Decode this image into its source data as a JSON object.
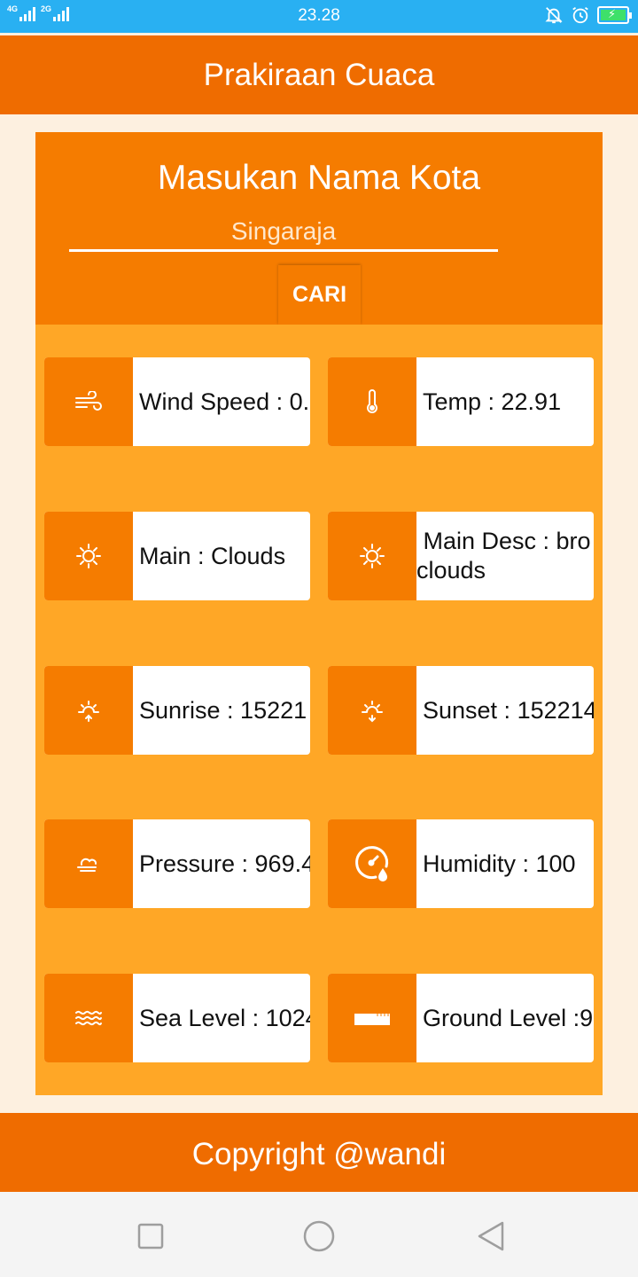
{
  "status_bar": {
    "network_1": "4G",
    "network_2": "2G",
    "time": "23.28",
    "icons": [
      "signal-icon",
      "signal-icon",
      "bell-off-icon",
      "alarm-icon",
      "battery-charging-icon"
    ]
  },
  "app_bar": {
    "title": "Prakiraan Cuaca"
  },
  "search": {
    "title": "Masukan Nama Kota",
    "city_value": "Singaraja",
    "button_label": "CARI"
  },
  "tiles": [
    {
      "icon": "wind-icon",
      "label": "Wind Speed : 0.",
      "interactable": false
    },
    {
      "icon": "thermometer-icon",
      "label": "Temp : 22.91"
    },
    {
      "icon": "sun-icon",
      "label": "Main : Clouds"
    },
    {
      "icon": "sun-icon",
      "label_line1": " Main Desc : bro",
      "label_line2": "clouds"
    },
    {
      "icon": "sunrise-icon",
      "label": "Sunrise : 15221"
    },
    {
      "icon": "sunset-icon",
      "label": "Sunset : 152214"
    },
    {
      "icon": "cloud-wind-icon",
      "label": "Pressure : 969.4"
    },
    {
      "icon": "humidity-gauge-icon",
      "label": "Humidity : 100"
    },
    {
      "icon": "waves-icon",
      "label": "Sea Level : 1024"
    },
    {
      "icon": "ground-level-icon",
      "label": "Ground Level :9"
    }
  ],
  "footer": {
    "text": "Copyright @wandi"
  },
  "colors": {
    "status_bar": "#29b0f2",
    "primary": "#ef6c00",
    "card": "#f57c00",
    "grid_bg": "#ffa726",
    "page_bg": "#fdf0e0"
  },
  "nav": {
    "icons": [
      "recent-apps-icon",
      "home-icon",
      "back-icon"
    ]
  }
}
